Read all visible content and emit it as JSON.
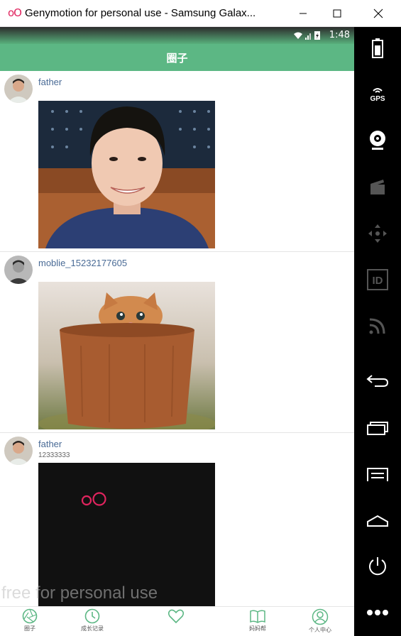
{
  "window": {
    "logo": "oO",
    "title": "Genymotion for personal use - Samsung Galax..."
  },
  "status": {
    "time": "1:48"
  },
  "appbar": {
    "title": "圈子"
  },
  "posts": [
    {
      "username": "father",
      "text": ""
    },
    {
      "username": "moblie_15232177605",
      "text": ""
    },
    {
      "username": "father",
      "text": "12333333"
    }
  ],
  "nav": {
    "items": [
      {
        "label": "圈子",
        "icon": "aperture-icon"
      },
      {
        "label": "成长记录",
        "icon": "clock-icon"
      },
      {
        "label": "",
        "icon": "heart-icon"
      },
      {
        "label": "妈妈帮",
        "icon": "book-icon"
      },
      {
        "label": "个人中心",
        "icon": "person-icon"
      }
    ]
  },
  "watermark": "free for personal use",
  "sidebar": {
    "gps_label": "GPS",
    "id_label": "ID",
    "items": [
      "battery-icon",
      "gps-icon",
      "webcam-icon",
      "clapperboard-icon",
      "dpad-icon",
      "id-icon",
      "rss-icon",
      "back-icon",
      "recent-apps-icon",
      "menu-icon",
      "home-icon",
      "power-icon",
      "more-icon"
    ]
  },
  "colors": {
    "accent": "#5cb784",
    "username": "#4a6b96",
    "logo": "#e0245e"
  }
}
